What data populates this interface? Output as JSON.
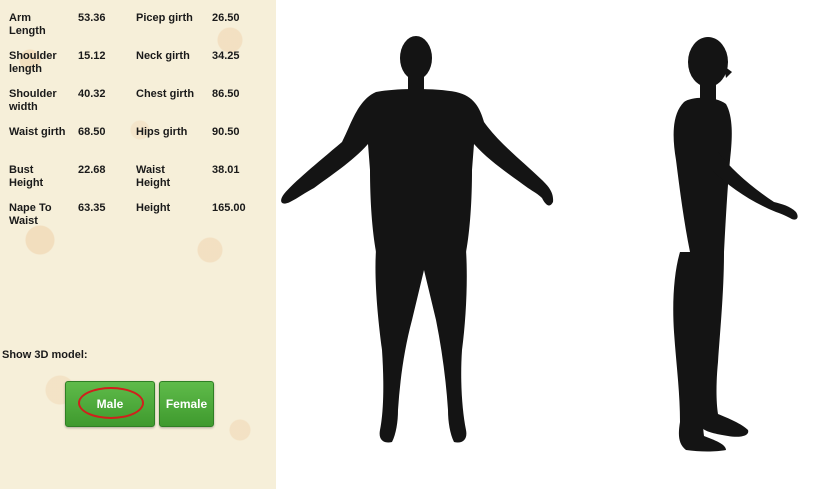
{
  "measurements": [
    {
      "label": "Arm Length",
      "value": "53.36"
    },
    {
      "label": "Picep girth",
      "value": "26.50"
    },
    {
      "label": "Shoulder length",
      "value": "15.12"
    },
    {
      "label": "Neck girth",
      "value": "34.25"
    },
    {
      "label": "Shoulder width",
      "value": "40.32"
    },
    {
      "label": "Chest girth",
      "value": "86.50"
    },
    {
      "label": "Waist girth",
      "value": "68.50"
    },
    {
      "label": "Hips girth",
      "value": "90.50"
    },
    {
      "label": "Bust Height",
      "value": "22.68"
    },
    {
      "label": "Waist Height",
      "value": "38.01"
    },
    {
      "label": "Nape To Waist",
      "value": "63.35"
    },
    {
      "label": "Height",
      "value": "165.00"
    }
  ],
  "model_section": {
    "label": "Show 3D model:",
    "male_button": "Male",
    "female_button": "Female",
    "selected": "Male"
  },
  "colors": {
    "panel_bg": "#f6efd9",
    "button_green": "#4caf3a",
    "highlight_ring": "#d0201c",
    "model_fill": "#141414"
  }
}
